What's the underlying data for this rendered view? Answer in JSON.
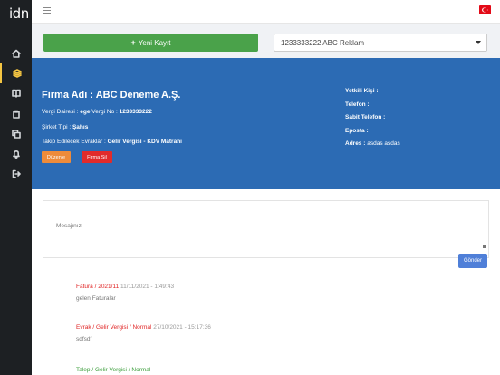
{
  "app": {
    "logo": "idn"
  },
  "sidebar": {
    "items": [
      {
        "name": "sidebar-item-home",
        "icon": "home-icon"
      },
      {
        "name": "sidebar-item-layers",
        "icon": "layers-icon",
        "active": true
      },
      {
        "name": "sidebar-item-book",
        "icon": "book-icon"
      },
      {
        "name": "sidebar-item-clipboard",
        "icon": "clipboard-icon"
      },
      {
        "name": "sidebar-item-copy",
        "icon": "copy-icon"
      },
      {
        "name": "sidebar-item-notifications",
        "icon": "bell-icon"
      },
      {
        "name": "sidebar-item-logout",
        "icon": "logout-icon"
      }
    ]
  },
  "topbar": {
    "flag": "turkey-flag-icon"
  },
  "actions": {
    "add_label": "Yeni Kayıt",
    "company_select": "1233333222 ABC Reklam"
  },
  "company": {
    "name": "Firma Adı : ABC Deneme A.Ş.",
    "tax_office_label": "Vergi Dairesi :",
    "tax_office": "ege",
    "tax_no_label": "Vergi No :",
    "tax_no": "1233333222",
    "type_label": "Şirket Tipi :",
    "type": "Şahıs",
    "tracked_label": "Takip Edilecek Evraklar :",
    "tracked": "Gelir Vergisi - KDV Matrahı",
    "edit_label": "Düzenle",
    "delete_label": "Firma Sil",
    "authorized_label": "Yetkili Kişi :",
    "phone_label": "Telefon :",
    "landline_label": "Sabit Telefon :",
    "email_label": "Eposta :",
    "address_label": "Adres :",
    "address": "asdas asdas"
  },
  "message": {
    "placeholder": "Mesajınız",
    "send_label": "Gönder"
  },
  "timeline": [
    {
      "category": "Fatura / 2021/11",
      "date": "11/11/2021 - 1:49:43",
      "text": "gelen Faturalar",
      "color": "#e02424"
    },
    {
      "category": "Evrak / Gelir Vergisi / Normal",
      "date": "27/10/2021 - 15:17:36",
      "text": "sdfsdf",
      "color": "#e02424"
    },
    {
      "category": "Talep / Gelir Vergisi / Normal",
      "date": "",
      "text": "",
      "color": "#3a9d3a"
    }
  ],
  "colors": {
    "primary": "#2c6bb4",
    "success": "#4aa24a",
    "warning": "#ee8b3a",
    "danger": "#e12b2b",
    "send": "#4f7fd8",
    "sidebar": "#1d2023"
  }
}
